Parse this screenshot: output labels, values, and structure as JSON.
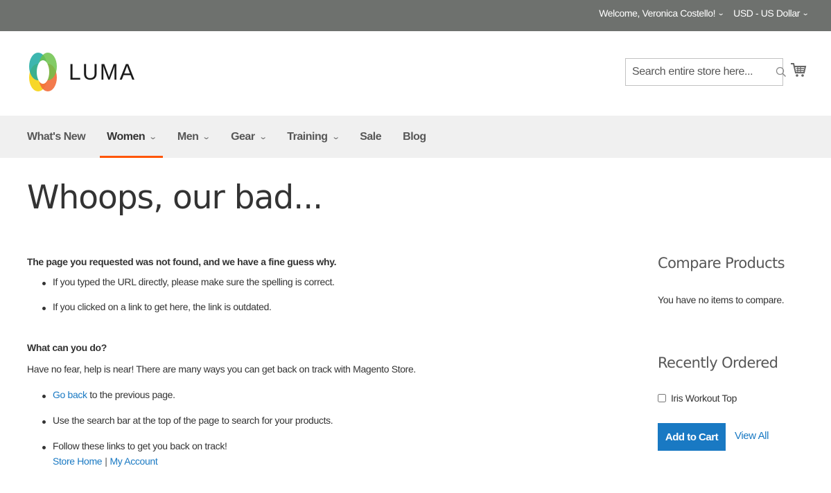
{
  "header_panel": {
    "welcome": "Welcome, Veronica Costello!",
    "currency": "USD - US Dollar"
  },
  "logo": {
    "text": "LUMA"
  },
  "search": {
    "placeholder": "Search entire store here..."
  },
  "nav": {
    "items": [
      {
        "label": "What's New"
      },
      {
        "label": "Women"
      },
      {
        "label": "Men"
      },
      {
        "label": "Gear"
      },
      {
        "label": "Training"
      },
      {
        "label": "Sale"
      },
      {
        "label": "Blog"
      }
    ]
  },
  "main": {
    "title": "Whoops, our bad...",
    "not_found_heading": "The page you requested was not found, and we have a fine guess why.",
    "reasons": [
      "If you typed the URL directly, please make sure the spelling is correct.",
      "If you clicked on a link to get here, the link is outdated."
    ],
    "what_heading": "What can you do?",
    "help_text": "Have no fear, help is near! There are many ways you can get back on track with Magento Store.",
    "go_back_link": "Go back",
    "go_back_rest": " to the previous page.",
    "search_tip": "Use the search bar at the top of the page to search for your products.",
    "follow_text": "Follow these links to get you back on track!",
    "store_home_link": "Store Home",
    "separator": "|",
    "my_account_link": "My Account"
  },
  "sidebar": {
    "compare_title": "Compare Products",
    "compare_empty": "You have no items to compare.",
    "recent_title": "Recently Ordered",
    "recent_item": "Iris Workout Top",
    "add_to_cart": "Add to Cart",
    "view_all": "View All"
  },
  "colors": {
    "top_bar": "#6e716e",
    "nav_active_underline": "#ff5501",
    "primary_button": "#1979c3",
    "link": "#1979c3"
  }
}
